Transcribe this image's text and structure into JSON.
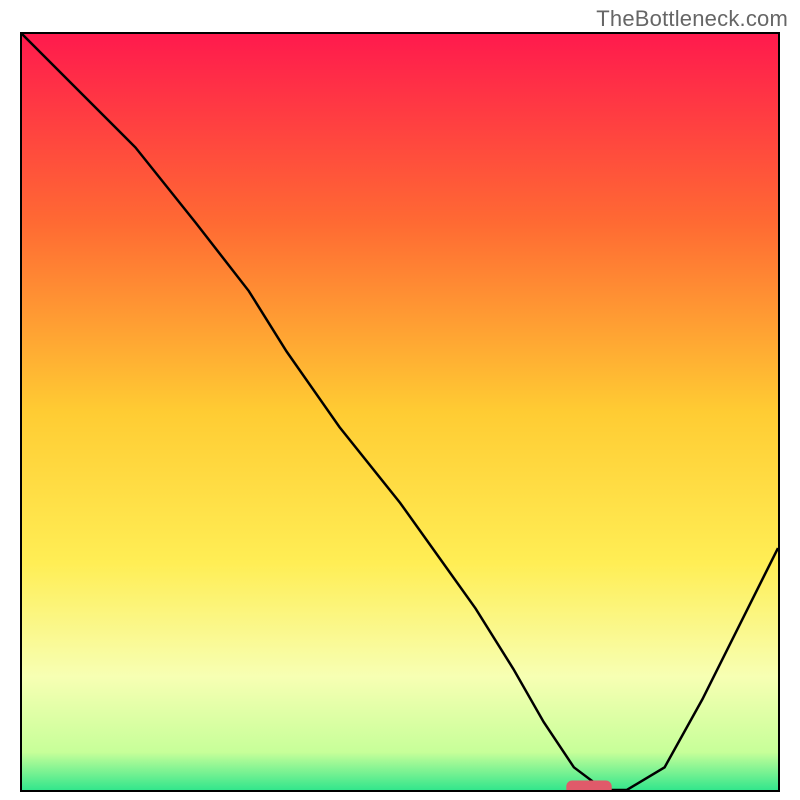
{
  "watermark": "TheBottleneck.com",
  "chart_data": {
    "type": "line",
    "title": "",
    "xlabel": "",
    "ylabel": "",
    "xlim": [
      0,
      100
    ],
    "ylim": [
      0,
      100
    ],
    "gradient_background": {
      "type": "vertical",
      "stops": [
        {
          "offset": 0,
          "color": "#ff1a4d"
        },
        {
          "offset": 25,
          "color": "#ff6a33"
        },
        {
          "offset": 50,
          "color": "#ffcc33"
        },
        {
          "offset": 70,
          "color": "#ffee55"
        },
        {
          "offset": 85,
          "color": "#f7ffb3"
        },
        {
          "offset": 95,
          "color": "#c7ff99"
        },
        {
          "offset": 100,
          "color": "#33e68c"
        }
      ]
    },
    "series": [
      {
        "name": "bottleneck-curve",
        "color": "#000000",
        "x": [
          0,
          8,
          15,
          23,
          30,
          35,
          42,
          50,
          55,
          60,
          65,
          69,
          73,
          77,
          80,
          85,
          90,
          95,
          100
        ],
        "y": [
          100,
          92,
          85,
          75,
          66,
          58,
          48,
          38,
          31,
          24,
          16,
          9,
          3,
          0,
          0,
          3,
          12,
          22,
          32
        ]
      }
    ],
    "marker": {
      "name": "optimal-marker",
      "color": "#e05a6a",
      "x": 75,
      "y": 0,
      "width": 6,
      "height": 2,
      "shape": "rounded-rect"
    }
  }
}
